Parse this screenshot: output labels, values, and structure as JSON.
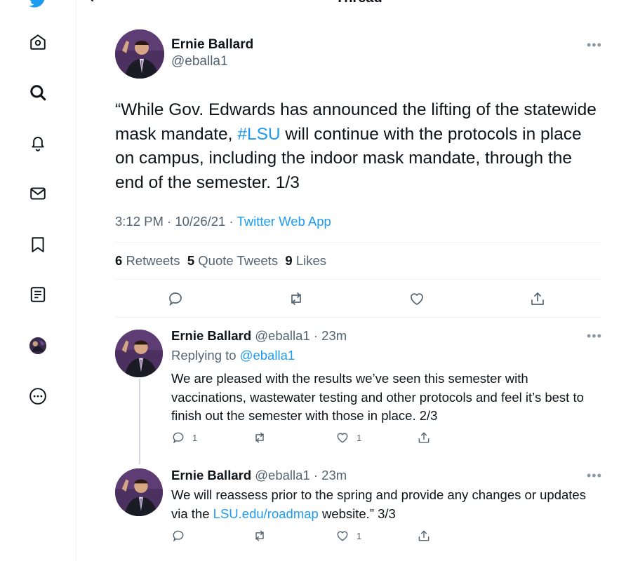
{
  "header": {
    "title": "Thread"
  },
  "sidebar": {
    "items": [
      {
        "name": "twitter-logo-icon"
      },
      {
        "name": "home-icon"
      },
      {
        "name": "explore-icon"
      },
      {
        "name": "notifications-icon"
      },
      {
        "name": "messages-icon"
      },
      {
        "name": "bookmarks-icon"
      },
      {
        "name": "lists-icon"
      },
      {
        "name": "profile-icon"
      },
      {
        "name": "more-icon"
      }
    ]
  },
  "main_tweet": {
    "display_name": "Ernie Ballard",
    "handle": "@eballa1",
    "text_part1": "“While Gov. Edwards has announced the lifting of the statewide mask mandate, ",
    "hashtag": "#LSU",
    "text_part2": " will continue with the protocols in place on campus, including the indoor mask mandate, through the end of the semester. 1/3",
    "time": "3:12 PM · 10/26/21 · ",
    "source": "Twitter Web App",
    "retweets_count": "6",
    "retweets_label": "Retweets",
    "quotes_count": "5",
    "quotes_label": "Quote Tweets",
    "likes_count": "9",
    "likes_label": "Likes"
  },
  "replies": [
    {
      "display_name": "Ernie Ballard",
      "handle_time": "@eballa1 · 23m",
      "replying_prefix": "Replying to ",
      "replying_to": "@eballa1",
      "text": "We are pleased with the results we’ve seen this semester with vaccinations, wastewater testing and other protocols and feel it’s best to finish out the semester with those in place. 2/3",
      "reply_count": "1",
      "retweet_count": "",
      "like_count": "1"
    },
    {
      "display_name": "Ernie Ballard",
      "handle_time": "@eballa1 · 23m",
      "text_part1": "We will reassess prior to the spring and provide any changes or updates via the ",
      "link": "LSU.edu/roadmap",
      "text_part2": " website.” 3/3",
      "reply_count": "",
      "retweet_count": "",
      "like_count": "1"
    }
  ],
  "colors": {
    "accent": "#1d9bf0",
    "text": "#0f1419",
    "muted": "#536471",
    "divider": "#eff3f4"
  }
}
